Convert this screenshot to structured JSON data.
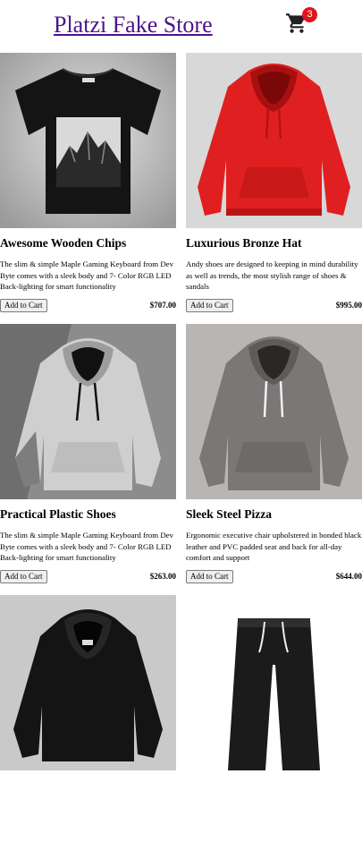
{
  "header": {
    "brand": "Platzi Fake Store",
    "cart_count": "3"
  },
  "products": [
    {
      "title": "Awesome Wooden Chips",
      "description": "The slim & simple Maple Gaming Keyboard from Dev Byte comes with a sleek body and 7- Color RGB LED Back-lighting for smart functionality",
      "price": "$707.00",
      "button_label": "Add to Cart",
      "image": "black t-shirt with mountain print"
    },
    {
      "title": "Luxurious Bronze Hat",
      "description": "Andy shoes are designed to keeping in mind durability as well as trends, the most stylish range of shoes & sandals",
      "price": "$995.00",
      "button_label": "Add to Cart",
      "image": "red hoodie"
    },
    {
      "title": "Practical Plastic Shoes",
      "description": "The slim & simple Maple Gaming Keyboard from Dev Byte comes with a sleek body and 7- Color RGB LED Back-lighting for smart functionality",
      "price": "$263.00",
      "button_label": "Add to Cart",
      "image": "light grey hoodie"
    },
    {
      "title": "Sleek Steel Pizza",
      "description": "Ergonomic executive chair upholstered in bonded black leather and PVC padded seat and back for all-day comfort and support",
      "price": "$644.00",
      "button_label": "Add to Cart",
      "image": "grey hoodie"
    },
    {
      "image": "black hoodie"
    },
    {
      "image": "black jogger pants"
    }
  ],
  "colors": {
    "brand": "#4a148c",
    "badge": "#e0161b",
    "button_bg": "#efefef"
  }
}
